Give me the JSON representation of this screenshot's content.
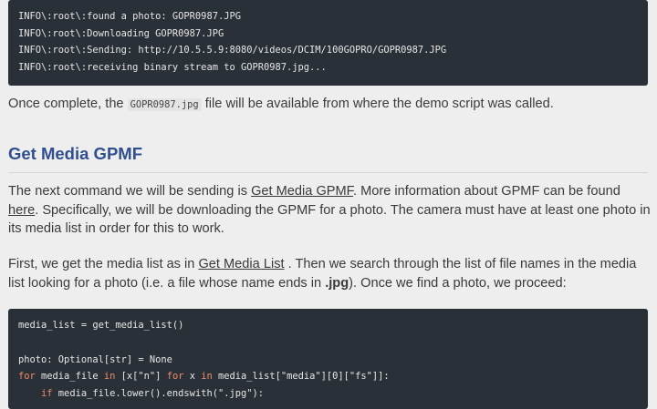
{
  "log_block": {
    "lines": [
      "INFO\\:root\\:found a photo: GOPR0987.JPG",
      "INFO\\:root\\:Downloading GOPR0987.JPG",
      "INFO\\:root\\:Sending: http://10.5.5.9:8080/videos/DCIM/100GOPRO/GOPR0987.JPG",
      "INFO\\:root\\:receiving binary stream to GOPR0987.jpg..."
    ]
  },
  "para_complete": {
    "before": "Once complete, the ",
    "code": "GOPR0987.jpg",
    "after": " file will be available from where the demo script was called."
  },
  "heading": "Get Media GPMF",
  "para_next": {
    "t1": "The next command we will be sending is ",
    "link1": "Get Media GPMF",
    "t2": ". More information about GPMF can be found ",
    "link2": "here",
    "t3": ". Specifically, we will be downloading the GPMF for a photo. The camera must have at least one photo in its media list in order for this to work."
  },
  "para_first": {
    "t1": "First, we get the media list as in ",
    "link1": "Get Media List",
    "t2": " . Then we search through the list of file names in the media list looking for a photo (i.e. a file whose name ends in ",
    "bold": ".jpg",
    "t3": "). Once we find a photo, we proceed:"
  },
  "code_block": {
    "line1": "media_list = get_media_list()",
    "line3": "photo: Optional[str] = None",
    "line4_kw1": "for",
    "line4_a": " media_file ",
    "line4_kw2": "in",
    "line4_b": " [x[\"n\"] ",
    "line4_kw3": "for",
    "line4_c": " x ",
    "line4_kw4": "in",
    "line4_d": " media_list[\"media\"][0][\"fs\"]]:",
    "line5_indent": "    ",
    "line5_kw": "if",
    "line5_rest": " media_file.lower().endswith(\".jpg\"):"
  }
}
